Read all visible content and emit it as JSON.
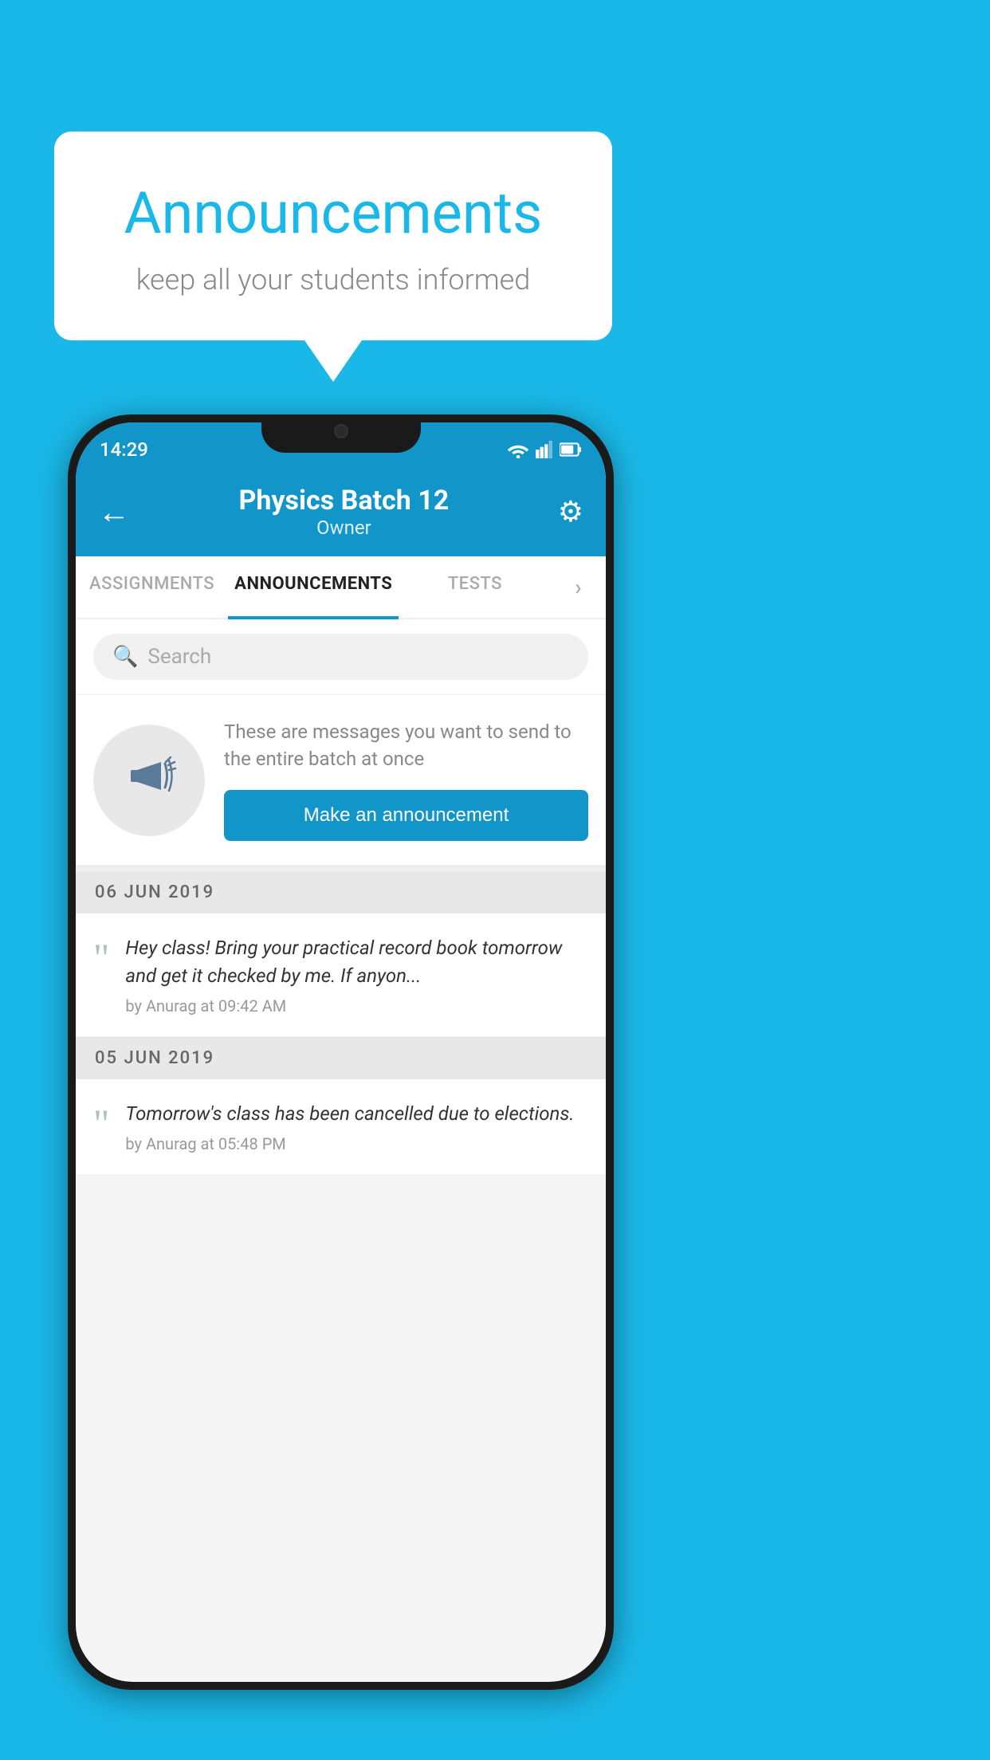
{
  "background_color": "#1ab8e8",
  "speech_bubble": {
    "title": "Announcements",
    "subtitle": "keep all your students informed"
  },
  "phone": {
    "status_bar": {
      "time": "14:29"
    },
    "header": {
      "title": "Physics Batch 12",
      "subtitle": "Owner",
      "back_label": "←",
      "gear_label": "⚙"
    },
    "tabs": [
      {
        "label": "ASSIGNMENTS",
        "active": false
      },
      {
        "label": "ANNOUNCEMENTS",
        "active": true
      },
      {
        "label": "TESTS",
        "active": false
      },
      {
        "label": "›",
        "active": false
      }
    ],
    "search": {
      "placeholder": "Search"
    },
    "announcement_prompt": {
      "description": "These are messages you want to send to the entire batch at once",
      "button_label": "Make an announcement"
    },
    "announcements": [
      {
        "date": "06  JUN  2019",
        "text": "Hey class! Bring your practical record book tomorrow and get it checked by me. If anyon...",
        "meta": "by Anurag at 09:42 AM"
      },
      {
        "date": "05  JUN  2019",
        "text": "Tomorrow's class has been cancelled due to elections.",
        "meta": "by Anurag at 05:48 PM"
      }
    ]
  }
}
